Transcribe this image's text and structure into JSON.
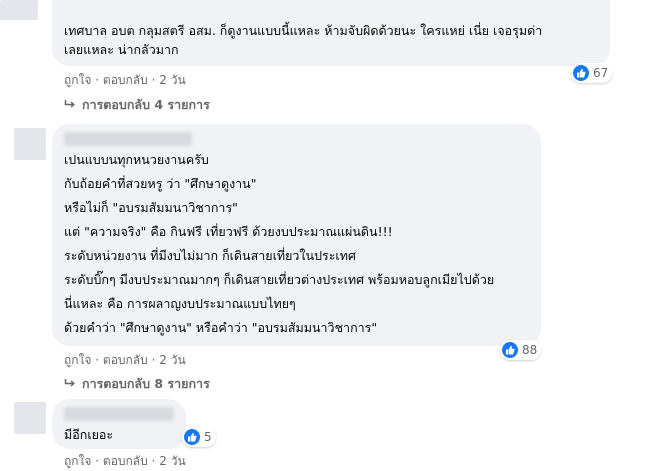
{
  "comments": [
    {
      "lines": [
        "เทศบาล อบต กลุมสตรี อสม. ก็ดูงานแบบนี้แหละ ห้ามจับผิดด้วยนะ ใครแหย่ เนี่ย เจอรุมด่า",
        "เลยแหละ น่ากลัวมาก"
      ],
      "reaction_count": "67",
      "like_label": "ถูกใจ",
      "reply_label": "ตอบกลับ",
      "time": "2 วัน",
      "replies_link": "การตอบกลับ 4 รายการ"
    },
    {
      "lines": [
        "เปนแบบนทุกหนวยงานครับ",
        "กับถ้อยคำที่สวยหรู ว่า \"ศึกษาดูงาน\"",
        "หรือไม่ก็ \"อบรมสัมมนาวิชาการ\"",
        "แต่ \"ความจริง\" คือ กินฟรี เที่ยวฟรี ด้วยงบประมาณแผ่นดิน!!!",
        "ระดับหน่วยงาน ที่มีงบไม่มาก ก็เดินสายเที่ยวในประเทศ",
        "ระดับบิ๊กๆ มีงบประมาณมากๆ ก็เดินสายเที่ยวต่างประเทศ พร้อมหอบลูกเมียไปด้วย",
        "นี่แหละ คือ การผลาญงบประมาณแบบไทยๆ",
        "ด้วยคำว่า \"ศึกษาดูงาน\" หรือคำว่า \"อบรมสัมมนาวิชาการ\""
      ],
      "reaction_count": "88",
      "like_label": "ถูกใจ",
      "reply_label": "ตอบกลับ",
      "time": "2 วัน",
      "replies_link": "การตอบกลับ 8 รายการ"
    },
    {
      "lines": [
        "มีอีกเยอะ"
      ],
      "reaction_count": "5",
      "like_label": "ถูกใจ",
      "reply_label": "ตอบกลับ",
      "time": "2 วัน"
    }
  ],
  "colors": {
    "bubble": "#f0f2f5",
    "meta_text": "#65676b",
    "like_blue": "#1877f2"
  },
  "icons": {
    "reaction": "thumbs-up-icon",
    "replies": "reply-arrow-icon"
  },
  "separator": "·"
}
